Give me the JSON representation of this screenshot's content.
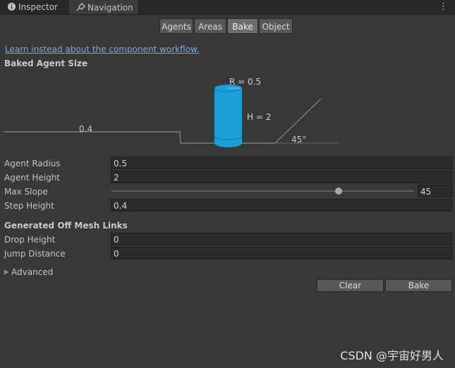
{
  "tabs": [
    {
      "label": "Inspector",
      "icon": "info-icon"
    },
    {
      "label": "Navigation",
      "icon": "navigation-icon"
    }
  ],
  "menu_icon": "kebab-menu-icon",
  "segments": [
    {
      "label": "Agents",
      "active": false
    },
    {
      "label": "Areas",
      "active": false
    },
    {
      "label": "Bake",
      "active": true
    },
    {
      "label": "Object",
      "active": false
    }
  ],
  "link_text": "Learn instead about the component workflow.",
  "baked_agent_size": {
    "header": "Baked Agent Size",
    "diagram": {
      "radius_label": "R = 0.5",
      "height_label": "H = 2",
      "step_label": "0.4",
      "slope_label": "45°"
    }
  },
  "agent_settings": {
    "radius_label": "Agent Radius",
    "radius_value": "0.5",
    "height_label": "Agent Height",
    "height_value": "2",
    "slope_label": "Max Slope",
    "slope_value": "45",
    "slope_range": [
      0,
      60
    ],
    "step_label": "Step Height",
    "step_value": "0.4"
  },
  "off_mesh": {
    "header": "Generated Off Mesh Links",
    "drop_label": "Drop Height",
    "drop_value": "0",
    "jump_label": "Jump Distance",
    "jump_value": "0"
  },
  "advanced_label": "Advanced",
  "buttons": {
    "clear": "Clear",
    "bake": "Bake"
  },
  "watermark": "CSDN @宇宙好男人",
  "colors": {
    "accent_blue": "#1a9fd9",
    "link": "#7aa7e8",
    "background": "#383838"
  }
}
